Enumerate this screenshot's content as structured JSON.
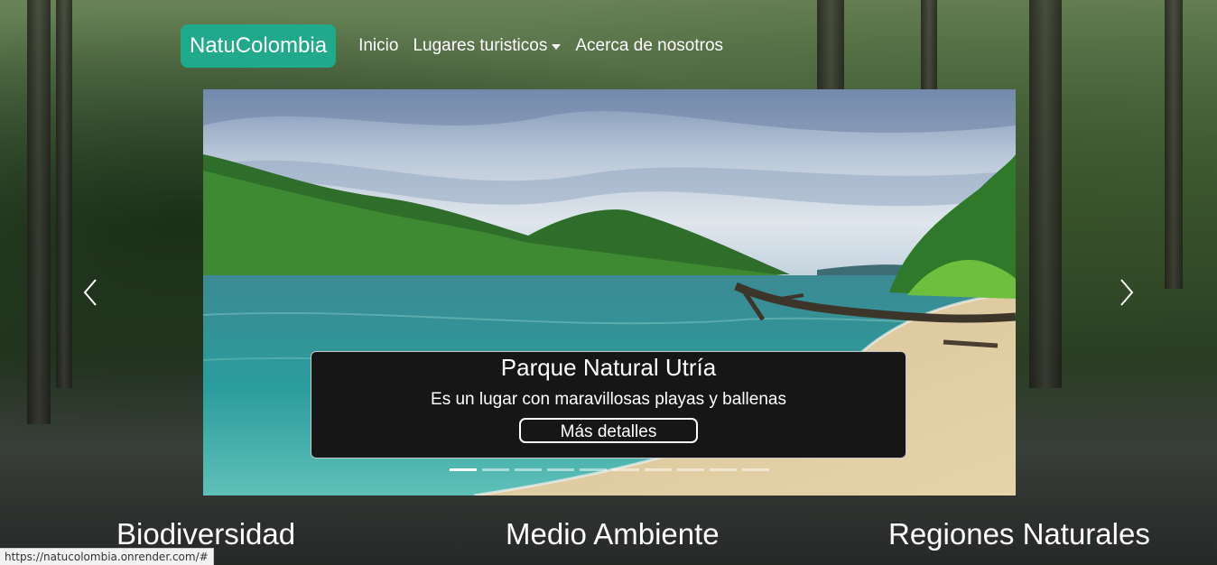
{
  "navbar": {
    "brand": "NatuColombia",
    "links": [
      {
        "label": "Inicio"
      },
      {
        "label": "Lugares turisticos",
        "has_dropdown": true
      },
      {
        "label": "Acerca de nosotros"
      }
    ],
    "brand_color": "#20a98b"
  },
  "carousel": {
    "slide": {
      "title": "Parque Natural Utría",
      "description": "Es un lugar con maravillosas playas y ballenas",
      "button_label": "Más detalles"
    },
    "indicator_count": 10,
    "active_index": 0,
    "prev_icon": "chevron-left-icon",
    "next_icon": "chevron-right-icon"
  },
  "sections": {
    "biodiversidad": "Biodiversidad",
    "medio_ambiente": "Medio Ambiente",
    "regiones": "Regiones Naturales"
  },
  "status_bar": {
    "url": "https://natucolombia.onrender.com/#"
  }
}
